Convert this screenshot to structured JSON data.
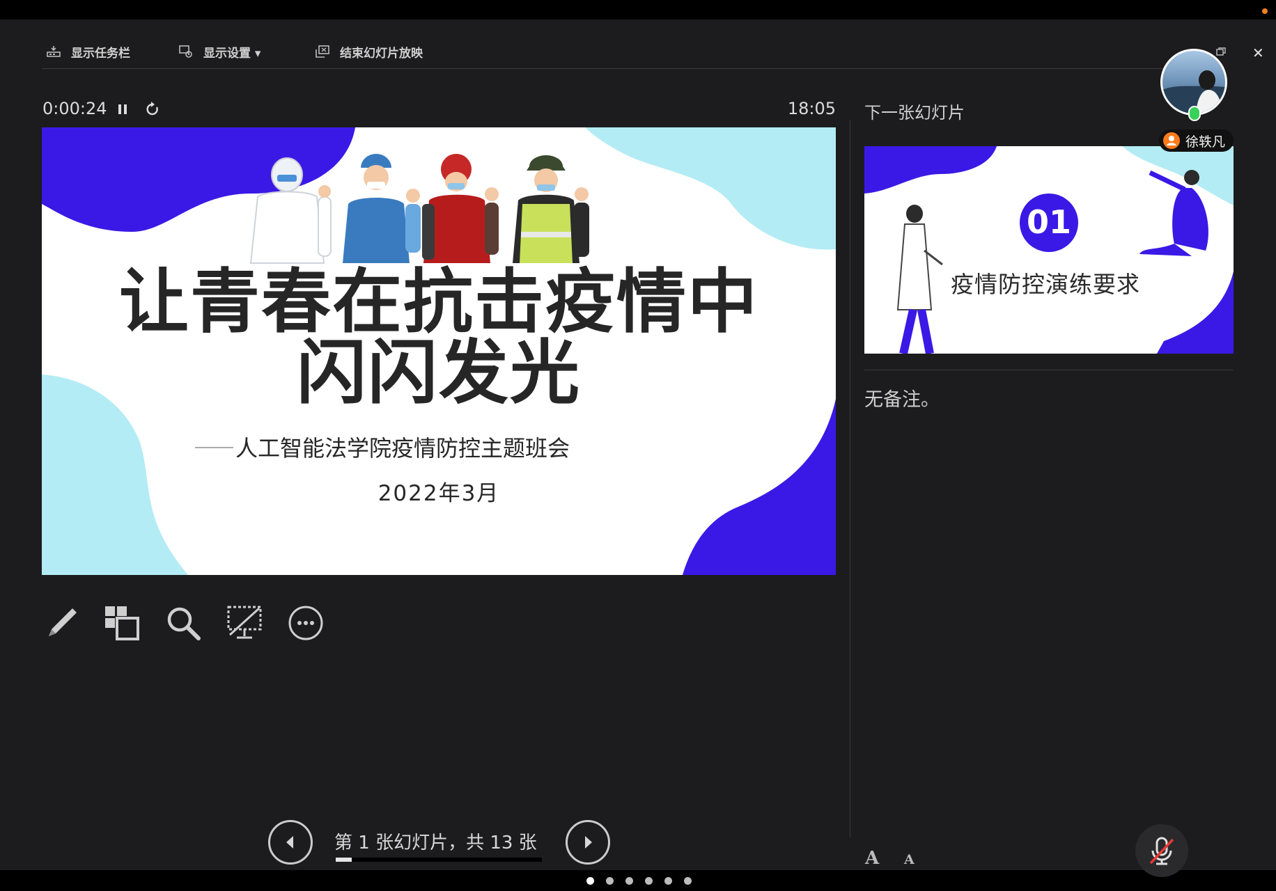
{
  "toolbar": {
    "show_taskbar": "显示任务栏",
    "display_settings": "显示设置 ▾",
    "end_slideshow": "结束幻灯片放映"
  },
  "presenter": {
    "elapsed_time": "0:00:24",
    "clock": "18:05",
    "next_slide_label": "下一张幻灯片",
    "notes": "无备注。"
  },
  "current_slide": {
    "title_line1": "让青春在抗击疫情中",
    "title_line2": "闪闪发光",
    "subtitle": "人工智能法学院疫情防控主题班会",
    "date": "2022年3月"
  },
  "next_slide": {
    "number": "01",
    "title": "疫情防控演练要求"
  },
  "navigation": {
    "label": "第 1 张幻灯片，共 13 张",
    "current": 1,
    "total": 13,
    "page_dots": 6,
    "active_dot": 0
  },
  "participant": {
    "name": "徐轶凡"
  },
  "font_controls": {
    "increase": "A",
    "decrease": "A"
  },
  "colors": {
    "slide_blue": "#3a19e6",
    "slide_cyan": "#b3ecf4",
    "mic_green": "#38d15a",
    "badge_orange": "#ff7a1a"
  }
}
